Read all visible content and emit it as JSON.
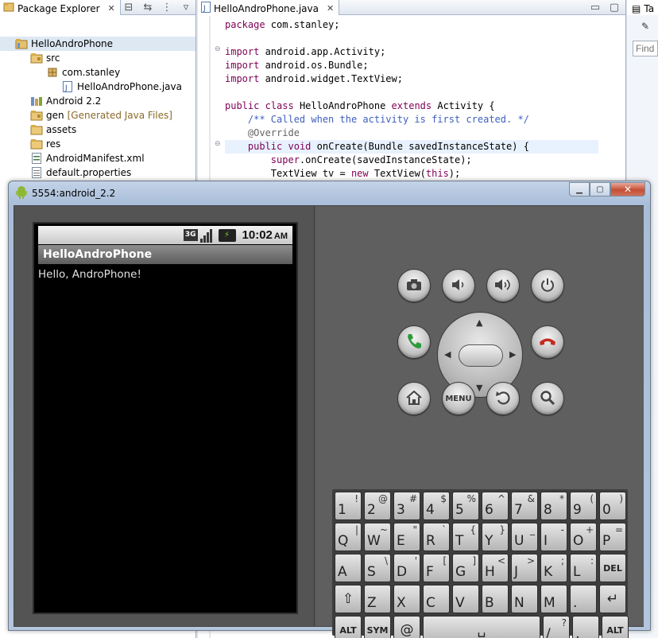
{
  "package_explorer": {
    "tab_label": "Package Explorer",
    "tree": [
      {
        "label": "HelloAndroPhone",
        "indent": 0,
        "icon": "project-icon",
        "selected": true
      },
      {
        "label": "src",
        "indent": 1,
        "icon": "source-folder-icon"
      },
      {
        "label": "com.stanley",
        "indent": 2,
        "icon": "package-icon"
      },
      {
        "label": "HelloAndroPhone.java",
        "indent": 3,
        "icon": "java-file-icon"
      },
      {
        "label": "Android 2.2",
        "indent": 1,
        "icon": "library-icon"
      },
      {
        "label": "gen",
        "hint": "[Generated Java Files]",
        "indent": 1,
        "icon": "gen-folder-icon"
      },
      {
        "label": "assets",
        "indent": 1,
        "icon": "folder-icon"
      },
      {
        "label": "res",
        "indent": 1,
        "icon": "folder-icon"
      },
      {
        "label": "AndroidManifest.xml",
        "indent": 1,
        "icon": "xml-file-icon"
      },
      {
        "label": "default.properties",
        "indent": 1,
        "icon": "properties-file-icon"
      }
    ]
  },
  "editor": {
    "tab_label": "HelloAndroPhone.java",
    "lines": [
      {
        "t": "package com.stanley;"
      },
      {
        "t": ""
      },
      {
        "t": "import android.app.Activity;"
      },
      {
        "t": "import android.os.Bundle;"
      },
      {
        "t": "import android.widget.TextView;"
      },
      {
        "t": ""
      },
      {
        "t": "public class HelloAndroPhone extends Activity {"
      },
      {
        "t": "    /** Called when the activity is first created. */"
      },
      {
        "t": "    @Override"
      },
      {
        "t": "    public void onCreate(Bundle savedInstanceState) {"
      },
      {
        "t": "        super.onCreate(savedInstanceState);"
      },
      {
        "t": "        TextView tv = new TextView(this);"
      }
    ]
  },
  "right_view": {
    "tab_label": "Ta",
    "find_placeholder": "Find"
  },
  "emulator": {
    "window_title": "5554:android_2.2",
    "window_buttons": {
      "minimize": "minimize-button",
      "maximize": "maximize-button",
      "close": "close-button"
    },
    "status_bar": {
      "network": "3G",
      "time": "10:02",
      "ampm": "AM"
    },
    "app_title": "HelloAndroPhone",
    "app_text": "Hello, AndroPhone!",
    "hardware_buttons": {
      "row1": [
        "camera-icon",
        "volume-down-icon",
        "volume-up-icon",
        "power-icon"
      ],
      "call": "call-icon",
      "end_call": "end-call-icon",
      "row3": [
        "home-icon",
        "MENU",
        "back-icon",
        "search-icon"
      ]
    },
    "keyboard": {
      "rows": [
        [
          {
            "m": "1",
            "s": "!"
          },
          {
            "m": "2",
            "s": "@"
          },
          {
            "m": "3",
            "s": "#"
          },
          {
            "m": "4",
            "s": "$"
          },
          {
            "m": "5",
            "s": "%"
          },
          {
            "m": "6",
            "s": "^"
          },
          {
            "m": "7",
            "s": "&"
          },
          {
            "m": "8",
            "s": "*"
          },
          {
            "m": "9",
            "s": "("
          },
          {
            "m": "0",
            "s": ")"
          }
        ],
        [
          {
            "m": "Q",
            "s": "|"
          },
          {
            "m": "W",
            "s": "~"
          },
          {
            "m": "E",
            "s": "\""
          },
          {
            "m": "R",
            "s": "`"
          },
          {
            "m": "T",
            "s": "{"
          },
          {
            "m": "Y",
            "s": "}"
          },
          {
            "m": "U",
            "s": "_"
          },
          {
            "m": "I",
            "s": "-"
          },
          {
            "m": "O",
            "s": "+"
          },
          {
            "m": "P",
            "s": "="
          }
        ],
        [
          {
            "m": "A",
            "s": ""
          },
          {
            "m": "S",
            "s": "\\"
          },
          {
            "m": "D",
            "s": "'"
          },
          {
            "m": "F",
            "s": "["
          },
          {
            "m": "G",
            "s": "]"
          },
          {
            "m": "H",
            "s": "<"
          },
          {
            "m": "J",
            "s": ">"
          },
          {
            "m": "K",
            "s": ";"
          },
          {
            "m": "L",
            "s": ":"
          },
          {
            "m": "DEL",
            "s": ""
          }
        ],
        [
          {
            "m": "⇧",
            "s": ""
          },
          {
            "m": "Z",
            "s": ""
          },
          {
            "m": "X",
            "s": ""
          },
          {
            "m": "C",
            "s": ""
          },
          {
            "m": "V",
            "s": ""
          },
          {
            "m": "B",
            "s": ""
          },
          {
            "m": "N",
            "s": ""
          },
          {
            "m": "M",
            "s": ""
          },
          {
            "m": ".",
            "s": ""
          },
          {
            "m": "↵",
            "s": ""
          }
        ],
        [
          {
            "m": "ALT",
            "s": ""
          },
          {
            "m": "SYM",
            "s": ""
          },
          {
            "m": "@",
            "s": ""
          },
          {
            "m": "␣",
            "s": ""
          },
          {
            "m": "/",
            "s": "?"
          },
          {
            "m": ",",
            "s": ""
          },
          {
            "m": "ALT",
            "s": ""
          }
        ]
      ]
    }
  },
  "colors": {
    "java_keyword": "#7f0055",
    "javadoc": "#3f5fbf",
    "annotation": "#646464",
    "emulator_skin": "#575757",
    "screen_bg": "#000000"
  }
}
